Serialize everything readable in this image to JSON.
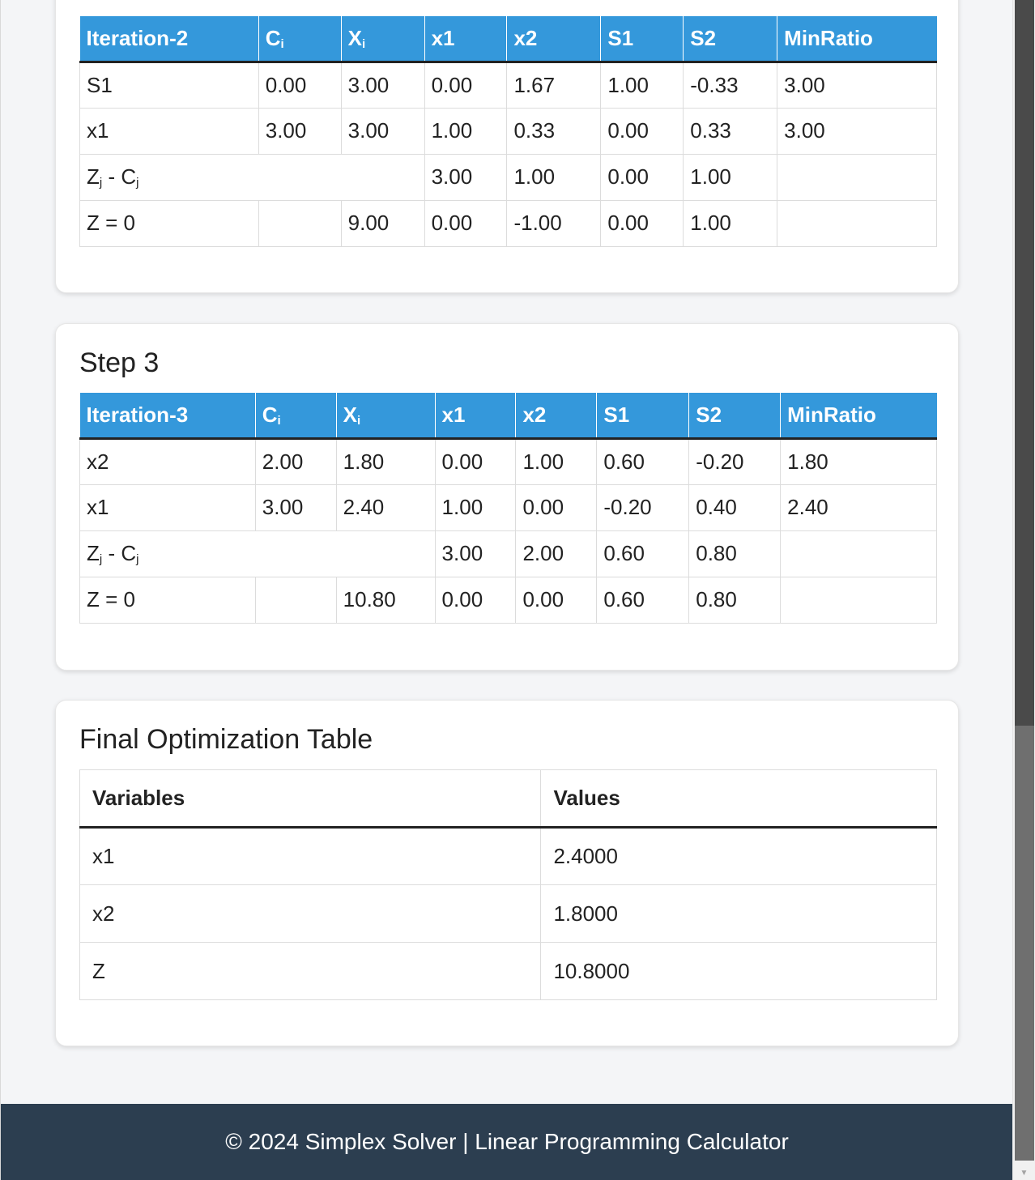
{
  "step2": {
    "headers": {
      "iteration": "Iteration-2",
      "ci": "C",
      "ci_sub": "i",
      "xi": "X",
      "xi_sub": "i",
      "x1": "x1",
      "x2": "x2",
      "s1": "S1",
      "s2": "S2",
      "minratio": "MinRatio"
    },
    "rows": [
      {
        "basis": "S1",
        "ci": "0.00",
        "xi": "3.00",
        "x1": "0.00",
        "x2": "1.67",
        "s1": "1.00",
        "s2": "-0.33",
        "ratio": "3.00"
      },
      {
        "basis": "x1",
        "ci": "3.00",
        "xi": "3.00",
        "x1": "1.00",
        "x2": "0.33",
        "s1": "0.00",
        "s2": "0.33",
        "ratio": "3.00"
      }
    ],
    "zjcj": {
      "z": "Z",
      "z_sub": "j",
      "dash": " - C",
      "c_sub": "j",
      "x1": "3.00",
      "x2": "1.00",
      "s1": "0.00",
      "s2": "1.00"
    },
    "zrow": {
      "label": "Z = 0",
      "xi": "9.00",
      "x1": "0.00",
      "x2": "-1.00",
      "s1": "0.00",
      "s2": "1.00"
    }
  },
  "step3": {
    "title": "Step 3",
    "headers": {
      "iteration": "Iteration-3",
      "ci": "C",
      "ci_sub": "i",
      "xi": "X",
      "xi_sub": "i",
      "x1": "x1",
      "x2": "x2",
      "s1": "S1",
      "s2": "S2",
      "minratio": "MinRatio"
    },
    "rows": [
      {
        "basis": "x2",
        "ci": "2.00",
        "xi": "1.80",
        "x1": "0.00",
        "x2": "1.00",
        "s1": "0.60",
        "s2": "-0.20",
        "ratio": "1.80"
      },
      {
        "basis": "x1",
        "ci": "3.00",
        "xi": "2.40",
        "x1": "1.00",
        "x2": "0.00",
        "s1": "-0.20",
        "s2": "0.40",
        "ratio": "2.40"
      }
    ],
    "zjcj": {
      "z": "Z",
      "z_sub": "j",
      "dash": " - C",
      "c_sub": "j",
      "x1": "3.00",
      "x2": "2.00",
      "s1": "0.60",
      "s2": "0.80"
    },
    "zrow": {
      "label": "Z = 0",
      "xi": "10.80",
      "x1": "0.00",
      "x2": "0.00",
      "s1": "0.60",
      "s2": "0.80"
    }
  },
  "final": {
    "title": "Final Optimization Table",
    "headers": {
      "variables": "Variables",
      "values": "Values"
    },
    "rows": [
      {
        "variable": "x1",
        "value": "2.4000"
      },
      {
        "variable": "x2",
        "value": "1.8000"
      },
      {
        "variable": "Z",
        "value": "10.8000"
      }
    ]
  },
  "footer": {
    "text": "© 2024 Simplex Solver | Linear Programming Calculator"
  },
  "colors": {
    "header_blue": "#3498db",
    "footer_bg": "#2c3e50",
    "page_bg": "#f4f5f7"
  }
}
